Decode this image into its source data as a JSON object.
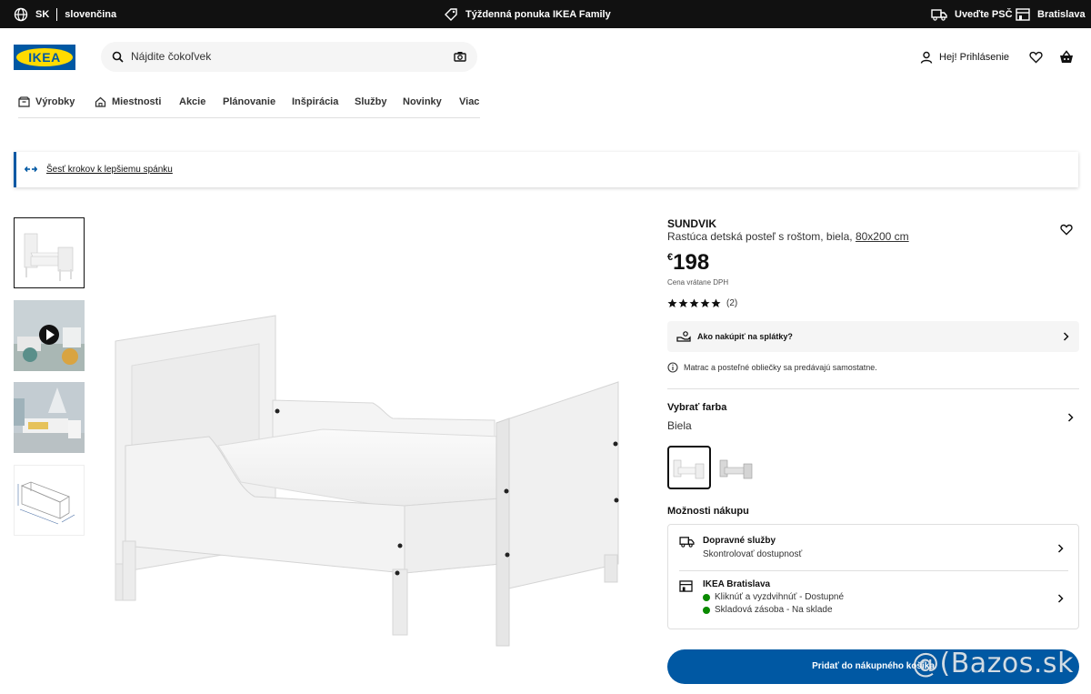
{
  "topbar": {
    "country": "SK",
    "language": "slovenčina",
    "promo": "Týždenná ponuka IKEA Family",
    "zip": "Uveďte PSČ",
    "store": "Bratislava"
  },
  "header": {
    "logo": "IKEA",
    "search_placeholder": "Nájdite čokoľvek",
    "login": "Hej! Prihlásenie"
  },
  "nav": {
    "items": [
      "Výrobky",
      "Miestnosti",
      "Akcie",
      "Plánovanie",
      "Inšpirácia",
      "Služby",
      "Novinky",
      "Viac"
    ]
  },
  "banner": {
    "text": "Šesť krokov k lepšiemu spánku"
  },
  "product": {
    "name": "SUNDVIK",
    "description": "Rastúca detská posteľ s roštom, biela,",
    "size": "80x200 cm",
    "currency": "€",
    "price": "198",
    "vat_note": "Cena vrátane DPH",
    "rating": 5,
    "review_count": "(2)",
    "installment": "Ako nakúpiť na splátky?",
    "note": "Matrac a posteľné obliečky sa predávajú samostatne.",
    "color_title": "Vybrať farba",
    "color_value": "Biela",
    "buy_title": "Možnosti nákupu",
    "delivery_title": "Dopravné služby",
    "delivery_sub": "Skontrolovať dostupnosť",
    "store_title": "IKEA Bratislava",
    "store_status_1": "Kliknúť a vyzdvihnúť - Dostupné",
    "store_status_2": "Skladová zásoba - Na sklade",
    "cart_button": "Pridať do nákupného košíka"
  },
  "watermark": "@(Bazos.sk",
  "colors": {
    "ikea_blue": "#0058a3",
    "ikea_yellow": "#ffdb00",
    "available_green": "#0a8a00",
    "topbar": "#111111"
  }
}
